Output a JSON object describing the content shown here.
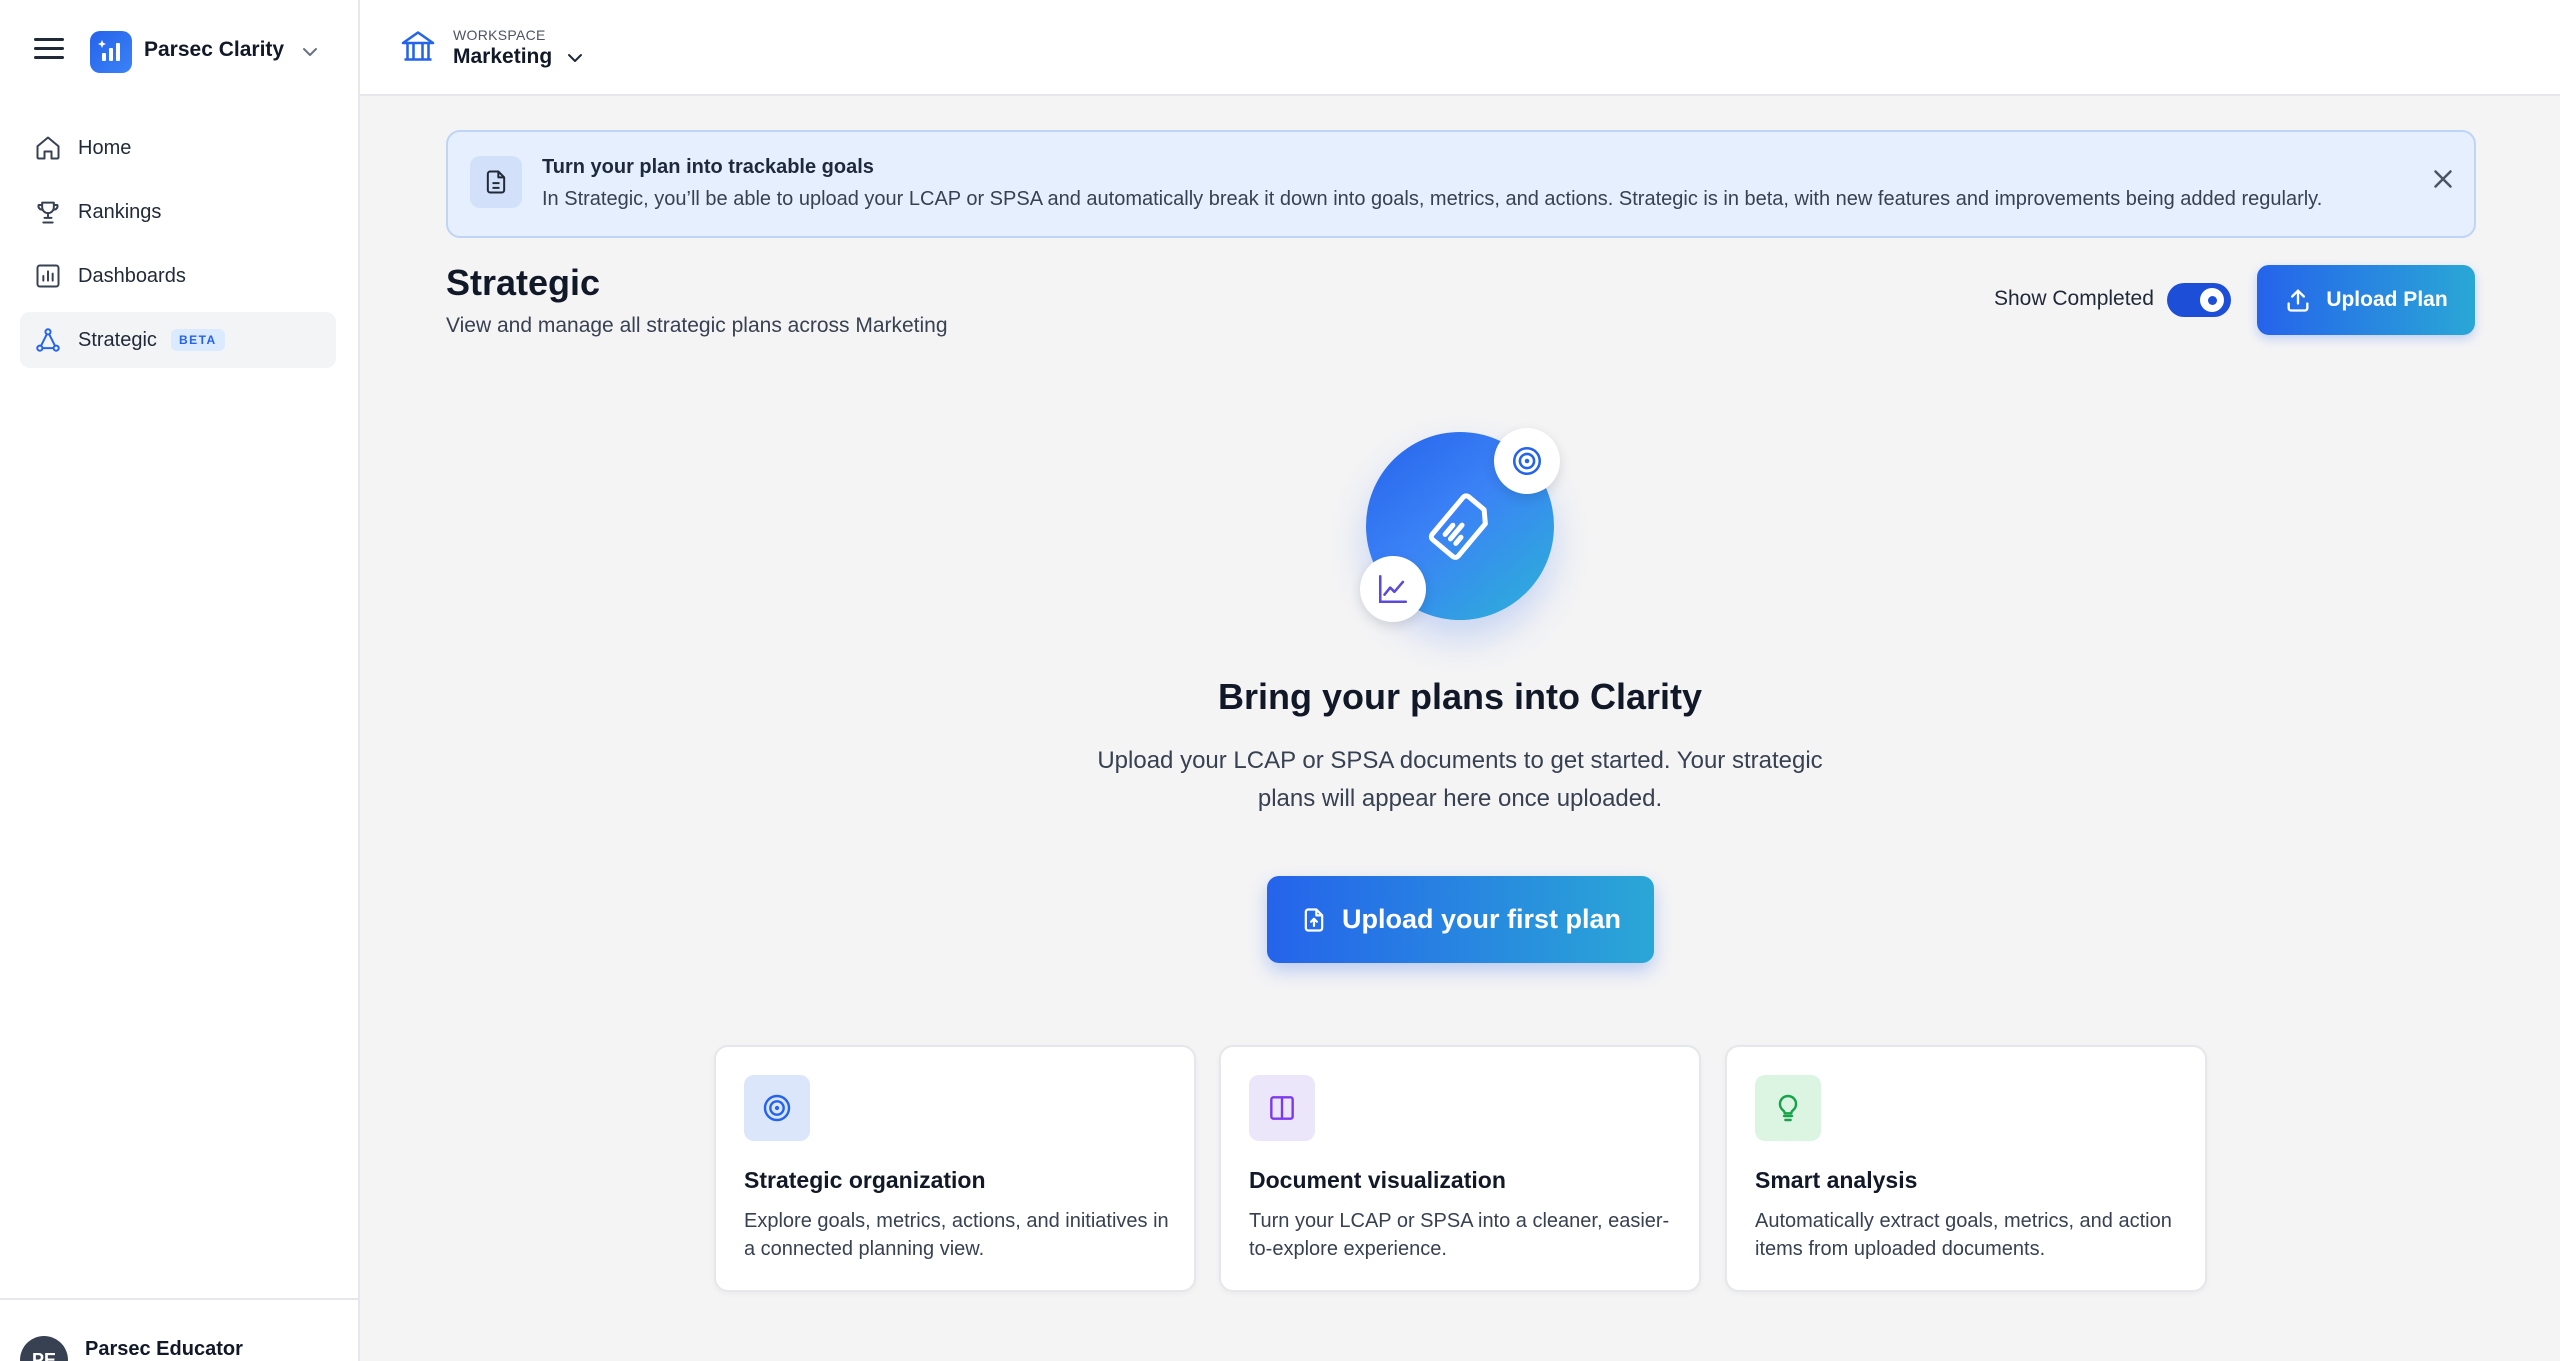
{
  "sidebar": {
    "brand": {
      "name": "Parsec Clarity"
    },
    "items": [
      {
        "label": "Home",
        "icon": "home-icon"
      },
      {
        "label": "Rankings",
        "icon": "trophy-icon"
      },
      {
        "label": "Dashboards",
        "icon": "dashboard-icon"
      },
      {
        "label": "Strategic",
        "icon": "network-icon",
        "badge": "BETA",
        "active": true
      }
    ],
    "user": {
      "initials": "PE",
      "name": "Parsec Educator"
    }
  },
  "topbar": {
    "workspace_caption": "WORKSPACE",
    "workspace_name": "Marketing"
  },
  "banner": {
    "title": "Turn your plan into trackable goals",
    "text": "In Strategic, you’ll be able to upload your LCAP or SPSA and automatically break it down into goals, metrics, and actions. Strategic is in beta, with new features and improvements being added regularly."
  },
  "page": {
    "title": "Strategic",
    "subtitle": "View and manage all strategic plans across Marketing",
    "toggle_label": "Show Completed",
    "toggle_on": true,
    "upload_label": "Upload Plan"
  },
  "empty_state": {
    "title": "Bring your plans into Clarity",
    "text": "Upload your LCAP or SPSA documents to get started. Your strategic plans will appear here once uploaded.",
    "cta_label": "Upload your first plan"
  },
  "features": [
    {
      "title": "Strategic organization",
      "text": "Explore goals, metrics, actions, and initiatives in a connected planning view.",
      "icon": "target-icon",
      "color": "#2563eb",
      "bg": "#dbe6fb"
    },
    {
      "title": "Document visualization",
      "text": "Turn your LCAP or SPSA into a cleaner, easier-to-explore experience.",
      "icon": "columns-icon",
      "color": "#7c3aed",
      "bg": "#ece6fb"
    },
    {
      "title": "Smart analysis",
      "text": "Automatically extract goals, metrics, and action items from uploaded documents.",
      "icon": "lightbulb-icon",
      "color": "#16a34a",
      "bg": "#dcf5e3"
    }
  ],
  "colors": {
    "accent": "#2563eb",
    "accent_end": "#2aa7d6",
    "banner_bg": "#e6effd"
  }
}
